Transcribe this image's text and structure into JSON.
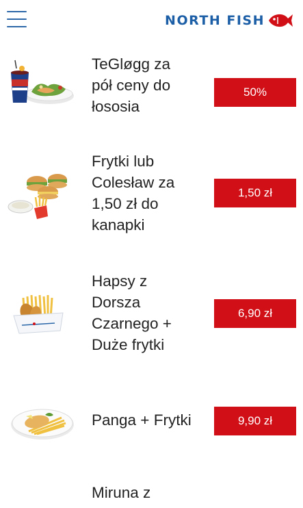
{
  "header": {
    "logo_text": "NORTH FISH"
  },
  "colors": {
    "brand_blue": "#1d5fa6",
    "price_red": "#d10f17"
  },
  "items": [
    {
      "name": "TeGløgg za\npół ceny do\nłososia",
      "price": "50%",
      "image": "drink-and-salmon-salad-image"
    },
    {
      "name": "Frytki lub\nColesław za\n1,50 zł do\nkanapki",
      "price": "1,50 zł",
      "image": "sandwiches-fries-coleslaw-image"
    },
    {
      "name": "Hapsy z\nDorsza\nCzarnego +\nDuże frytki",
      "price": "6,90 zł",
      "image": "fish-bites-fries-box-image"
    },
    {
      "name": "Panga + Frytki",
      "price": "9,90 zł",
      "image": "panga-fries-plate-image"
    },
    {
      "name": "Miruna z",
      "price": "",
      "image": ""
    }
  ]
}
